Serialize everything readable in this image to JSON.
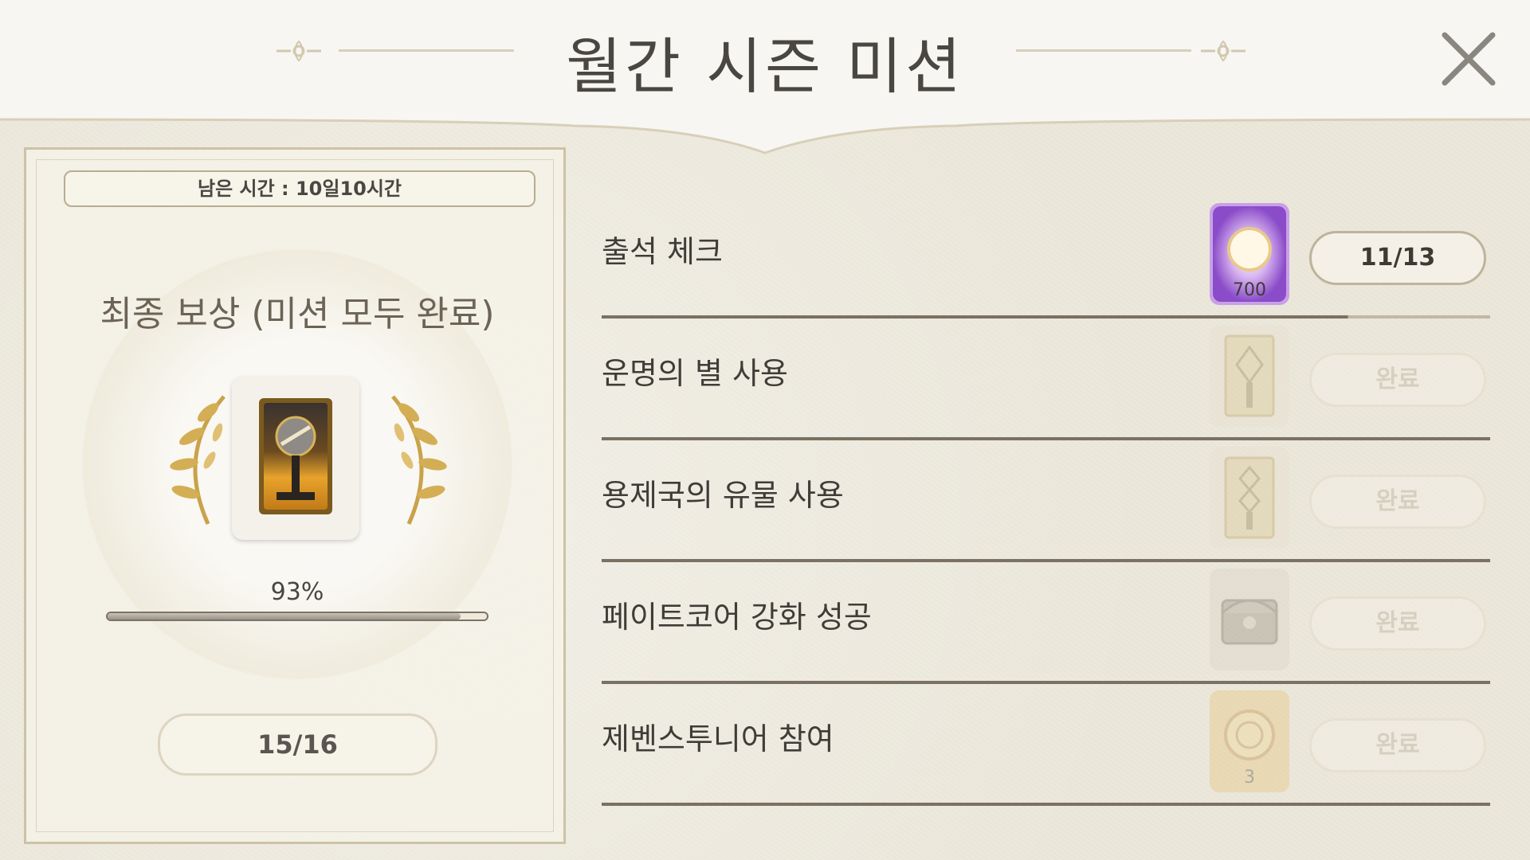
{
  "header": {
    "title": "월간 시즌 미션"
  },
  "left_panel": {
    "timer": "남은 시간 : 10일10시간",
    "final_reward_title": "최종 보상 (미션 모두 완료)",
    "progress_percent_label": "93%",
    "progress_value": 0.93,
    "completed_count": "15/16"
  },
  "missions": [
    {
      "label": "출석 체크",
      "reward_badge": "700",
      "reward_icon": "purple-gem-icon",
      "status": "11/13",
      "done": false
    },
    {
      "label": "운명의 별 사용",
      "reward_badge": "",
      "reward_icon": "fate-card-icon",
      "status": "완료",
      "done": true
    },
    {
      "label": "용제국의 유물 사용",
      "reward_badge": "",
      "reward_icon": "relic-card-icon",
      "status": "완료",
      "done": true
    },
    {
      "label": "페이트코어 강화 성공",
      "reward_badge": "",
      "reward_icon": "chest-icon",
      "status": "완료",
      "done": true
    },
    {
      "label": "제벤스투니어 참여",
      "reward_badge": "3",
      "reward_icon": "gold-coin-icon",
      "status": "완료",
      "done": true
    }
  ],
  "colors": {
    "accent_gold": "#c9a24a",
    "line": "#7a7163",
    "background": "#ebe7da"
  }
}
